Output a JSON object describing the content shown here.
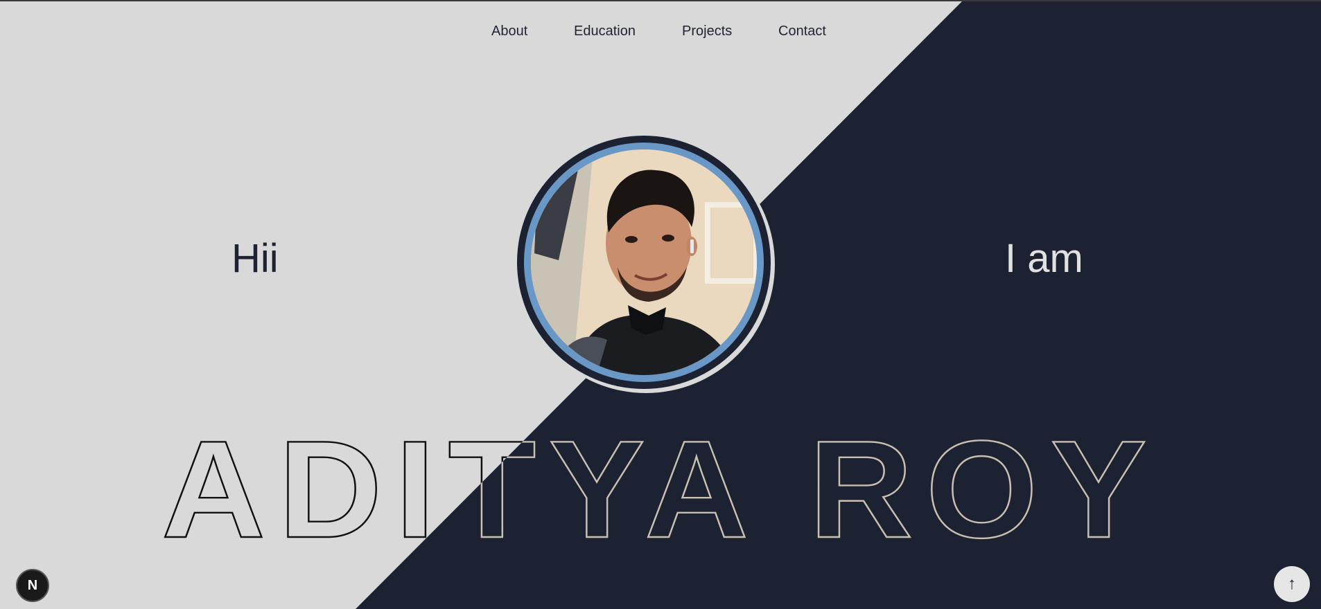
{
  "nav": {
    "items": [
      {
        "label": "About"
      },
      {
        "label": "Education"
      },
      {
        "label": "Projects"
      },
      {
        "label": "Contact"
      }
    ]
  },
  "hero": {
    "greeting_left": "Hii",
    "greeting_right": "I am",
    "name": "ADITYA ROY",
    "profile_photo": "profile-photo"
  },
  "badges": {
    "next_label": "N",
    "scroll_top_icon": "↑"
  },
  "colors": {
    "light_bg": "#d9d9d9",
    "dark_bg": "#1d2233",
    "ring_blue": "#6a98c6",
    "outline_light": "#c9c0b2",
    "outline_dark": "#111111"
  }
}
